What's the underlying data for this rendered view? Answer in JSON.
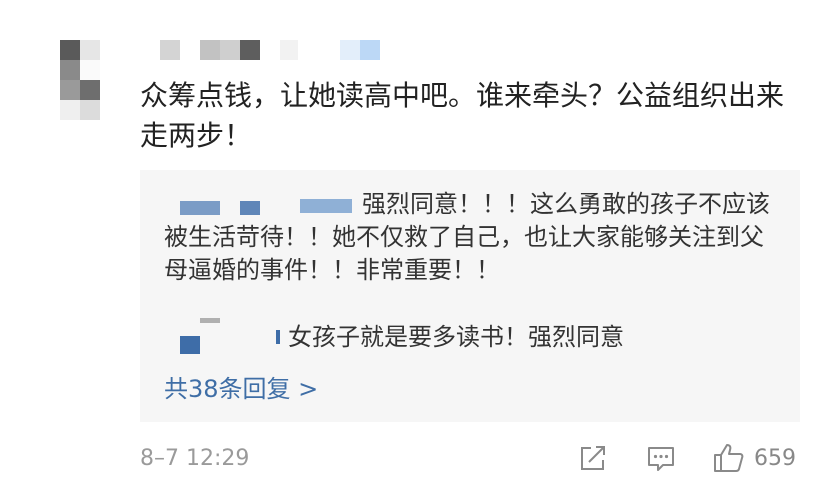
{
  "comment": {
    "text": "众筹点钱，让她读高中吧。谁来牵头？公益组织出来走两步！",
    "timestamp": "8–7 12:29",
    "likes": "659"
  },
  "replies": [
    {
      "text": "强烈同意！！！这么勇敢的孩子不应该被生活苛待！！她不仅救了自己，也让大家能够关注到父母逼婚的事件！！非常重要！！"
    },
    {
      "text": "女孩子就是要多读书！强烈同意"
    }
  ],
  "more_replies_label": "共38条回复 >",
  "icons": {
    "share": "share-icon",
    "reply": "comment-icon",
    "like": "thumbs-up-icon"
  },
  "colors": {
    "link": "#3f6ea6",
    "reply_bg": "#f6f6f6",
    "meta": "#9a9a9a"
  }
}
